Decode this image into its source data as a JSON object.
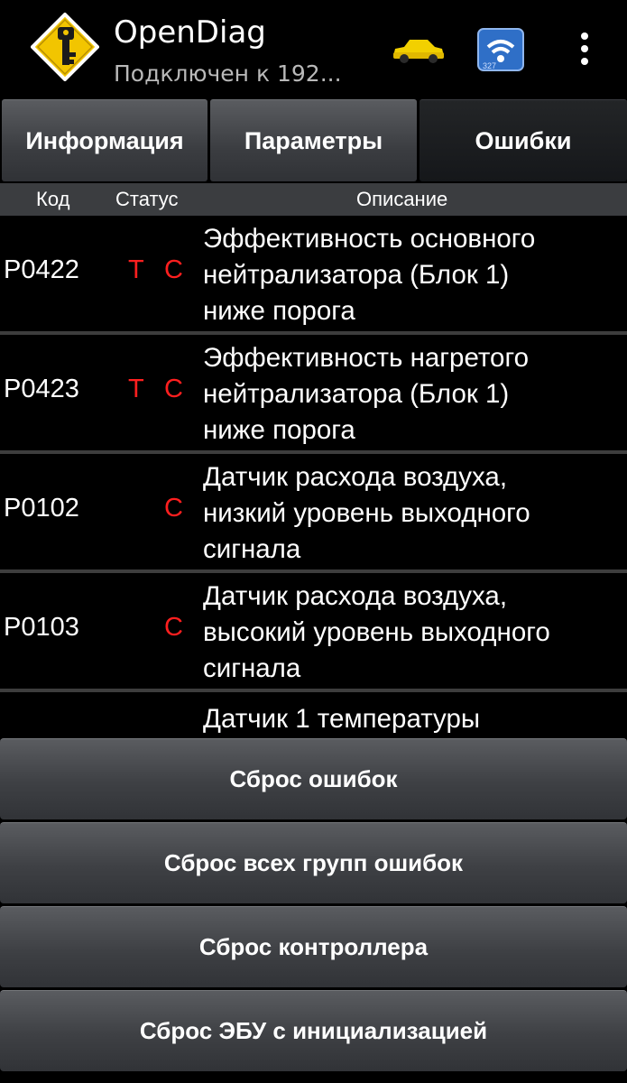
{
  "app": {
    "title": "OpenDiag",
    "subtitle": "Подключен к 192..."
  },
  "actionbar": {
    "logo_icon": "yellow-diamond-key-icon",
    "car_icon": "yellow-car-icon",
    "wifi_icon": "wifi-adapter-icon",
    "overflow_icon": "more-vert-icon"
  },
  "tabs": [
    {
      "label": "Информация",
      "active": false
    },
    {
      "label": "Параметры",
      "active": false
    },
    {
      "label": "Ошибки",
      "active": true
    }
  ],
  "table": {
    "headers": {
      "code": "Код",
      "status": "Статус",
      "description": "Описание"
    },
    "rows": [
      {
        "code": "P0422",
        "status_t": "T",
        "status_c": "C",
        "desc": [
          "Эффективность основного",
          "нейтрализатора (Блок 1)",
          "ниже порога"
        ]
      },
      {
        "code": "P0423",
        "status_t": "T",
        "status_c": "C",
        "desc": [
          "Эффективность нагретого",
          "нейтрализатора (Блок 1)",
          "ниже порога"
        ]
      },
      {
        "code": "P0102",
        "status_t": "",
        "status_c": "C",
        "desc": [
          "Датчик расхода воздуха,",
          "низкий уровень выходного",
          "сигнала"
        ]
      },
      {
        "code": "P0103",
        "status_t": "",
        "status_c": "C",
        "desc": [
          "Датчик расхода воздуха,",
          "высокий уровень выходного",
          "сигнала"
        ]
      },
      {
        "code": "",
        "status_t": "",
        "status_c": "",
        "desc": [
          "Датчик 1 температуры",
          "",
          ""
        ]
      }
    ]
  },
  "buttons": {
    "reset_errors": "Сброс ошибок",
    "reset_all_groups": "Сброс всех групп ошибок",
    "reset_controller": "Сброс контроллера",
    "reset_ecu_init": "Сброс ЭБУ с инициализацией"
  },
  "colors": {
    "status_red": "#ff1f1f",
    "logo_yellow": "#f2c500",
    "background": "#000000"
  }
}
